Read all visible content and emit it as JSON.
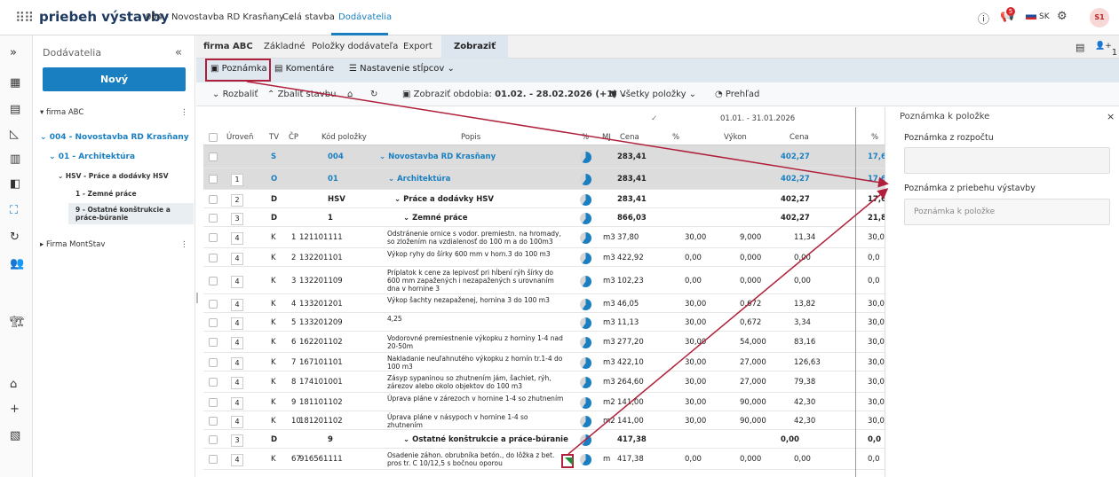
{
  "topbar": {
    "brand": "priebeh výstavby",
    "project": "004 - Novostavba RD Krasňany",
    "nav_items": [
      "Celá stavba",
      "Dodávatelia"
    ],
    "notif_count": "5",
    "lang": "SK",
    "avatar": "S1"
  },
  "sidebar": {
    "header": "Dodávatelia",
    "new_button": "Nový",
    "tree": [
      {
        "label": "firma ABC"
      },
      {
        "label": "004 - Novostavba RD Krasňany"
      },
      {
        "label": "01 - Architektúra"
      },
      {
        "label": "HSV - Práce a dodávky HSV"
      },
      {
        "label": "1 - Zemné práce"
      },
      {
        "label": "9 - Ostatné konštrukcie a práce-búranie"
      },
      {
        "label": "Firma MontStav"
      }
    ]
  },
  "tabs": {
    "company": "firma ABC",
    "items": [
      "Základné",
      "Položky dodávateľa",
      "Export",
      "Zobraziť"
    ],
    "right_count": "1"
  },
  "toolbar1": {
    "note": "Poznámka",
    "comments": "Komentáre",
    "columns": "Nastavenie stĺpcov"
  },
  "toolbar2": {
    "expand": "Rozbaliť",
    "collapse": "Zbaliť stavbu",
    "periods": "Zobraziť obdobia:",
    "period_value": "01.02. - 28.02.2026 (+1)",
    "filter": "Všetky položky",
    "overview": "Prehľad"
  },
  "table": {
    "headers": {
      "level": "Úroveň",
      "tv": "TV",
      "cp": "ČP",
      "code": "Kód položky",
      "desc": "Popis",
      "pct": "%",
      "mj": "MJ",
      "price": "Cena",
      "period": "01.01. - 31.01.2026",
      "p_pct": "%",
      "p_vykon": "Výkon",
      "p_price": "Cena",
      "r_pct": "%"
    },
    "rows": [
      {
        "lvl": "",
        "tv": "S",
        "cp": "",
        "code": "004",
        "desc": "Novostavba RD Krasňany",
        "mj": "",
        "cena": "283,41",
        "pp": "",
        "vykon": "",
        "pc": "402,27",
        "rp": "17,6",
        "type": "grp"
      },
      {
        "lvl": "1",
        "tv": "O",
        "cp": "",
        "code": "01",
        "desc": "Architektúra",
        "mj": "",
        "cena": "283,41",
        "pp": "",
        "vykon": "",
        "pc": "402,27",
        "rp": "17,6",
        "type": "grp"
      },
      {
        "lvl": "2",
        "tv": "D",
        "cp": "",
        "code": "HSV",
        "desc": "Práce a dodávky HSV",
        "mj": "",
        "cena": "283,41",
        "pp": "",
        "vykon": "",
        "pc": "402,27",
        "rp": "17,6",
        "type": "bold"
      },
      {
        "lvl": "3",
        "tv": "D",
        "cp": "",
        "code": "1",
        "desc": "Zemné práce",
        "mj": "",
        "cena": "866,03",
        "pp": "",
        "vykon": "",
        "pc": "402,27",
        "rp": "21,8",
        "type": "bold"
      },
      {
        "lvl": "4",
        "tv": "K",
        "cp": "1",
        "code": "121101111",
        "desc": "Odstránenie ornice s vodor. premiestn. na hromady, so zložením na vzdialenosť do 100 m a do 100m3",
        "mj": "m3",
        "cena": "37,80",
        "pp": "30,00",
        "vykon": "9,000",
        "pc": "11,34",
        "rp": "30,0"
      },
      {
        "lvl": "4",
        "tv": "K",
        "cp": "2",
        "code": "132201101",
        "desc": "Výkop ryhy do šírky 600 mm v horn.3 do 100 m3",
        "mj": "m3",
        "cena": "422,92",
        "pp": "0,00",
        "vykon": "0,000",
        "pc": "0,00",
        "rp": "0,0"
      },
      {
        "lvl": "4",
        "tv": "K",
        "cp": "3",
        "code": "132201109",
        "desc": "Príplatok k cene za lepivosť pri hĺbení rýh šírky do 600 mm zapažených i nezapažených s urovnaním dna v hornine 3",
        "mj": "m3",
        "cena": "102,23",
        "pp": "0,00",
        "vykon": "0,000",
        "pc": "0,00",
        "rp": "0,0"
      },
      {
        "lvl": "4",
        "tv": "K",
        "cp": "4",
        "code": "133201201",
        "desc": "Výkop šachty nezapaženej, hornina 3 do 100 m3",
        "mj": "m3",
        "cena": "46,05",
        "pp": "30,00",
        "vykon": "0,672",
        "pc": "13,82",
        "rp": "30,0"
      },
      {
        "lvl": "4",
        "tv": "K",
        "cp": "5",
        "code": "133201209",
        "desc": "4,25",
        "mj": "m3",
        "cena": "11,13",
        "pp": "30,00",
        "vykon": "0,672",
        "pc": "3,34",
        "rp": "30,0"
      },
      {
        "lvl": "4",
        "tv": "K",
        "cp": "6",
        "code": "162201102",
        "desc": "Vodorovné premiestnenie výkopku z horniny 1-4 nad 20-50m",
        "mj": "m3",
        "cena": "277,20",
        "pp": "30,00",
        "vykon": "54,000",
        "pc": "83,16",
        "rp": "30,0"
      },
      {
        "lvl": "4",
        "tv": "K",
        "cp": "7",
        "code": "167101101",
        "desc": "Nakladanie neuľahnutého výkopku z hornín tr.1-4 do 100 m3",
        "mj": "m3",
        "cena": "422,10",
        "pp": "30,00",
        "vykon": "27,000",
        "pc": "126,63",
        "rp": "30,0"
      },
      {
        "lvl": "4",
        "tv": "K",
        "cp": "8",
        "code": "174101001",
        "desc": "Zásyp sypaninou so zhutnením jám, šachiet, rýh, zárezov alebo okolo objektov do 100 m3",
        "mj": "m3",
        "cena": "264,60",
        "pp": "30,00",
        "vykon": "27,000",
        "pc": "79,38",
        "rp": "30,0"
      },
      {
        "lvl": "4",
        "tv": "K",
        "cp": "9",
        "code": "181101102",
        "desc": "Úprava pláne v zárezoch v hornine 1-4 so zhutnením",
        "mj": "m2",
        "cena": "141,00",
        "pp": "30,00",
        "vykon": "90,000",
        "pc": "42,30",
        "rp": "30,0"
      },
      {
        "lvl": "4",
        "tv": "K",
        "cp": "10",
        "code": "181201102",
        "desc": "Úprava pláne v násypoch v hornine 1-4 so zhutnením",
        "mj": "m2",
        "cena": "141,00",
        "pp": "30,00",
        "vykon": "90,000",
        "pc": "42,30",
        "rp": "30,0"
      },
      {
        "lvl": "3",
        "tv": "D",
        "cp": "",
        "code": "9",
        "desc": "Ostatné konštrukcie a práce-búranie",
        "mj": "",
        "cena": "417,38",
        "pp": "",
        "vykon": "",
        "pc": "0,00",
        "rp": "0,0",
        "type": "bold"
      },
      {
        "lvl": "4",
        "tv": "K",
        "cp": "67",
        "code": "916561111",
        "desc": "Osadenie záhon. obrubníka betón., do lôžka z bet. pros tr. C 10/12,5 s bočnou oporou",
        "mj": "m",
        "cena": "417,38",
        "pp": "0,00",
        "vykon": "0,000",
        "pc": "0,00",
        "rp": "0,0"
      }
    ]
  },
  "panel": {
    "title": "Poznámka k položke",
    "budget_label": "Poznámka z rozpočtu",
    "progress_label": "Poznámka z priebehu výstavby",
    "progress_placeholder": "Poznámka k položke"
  }
}
